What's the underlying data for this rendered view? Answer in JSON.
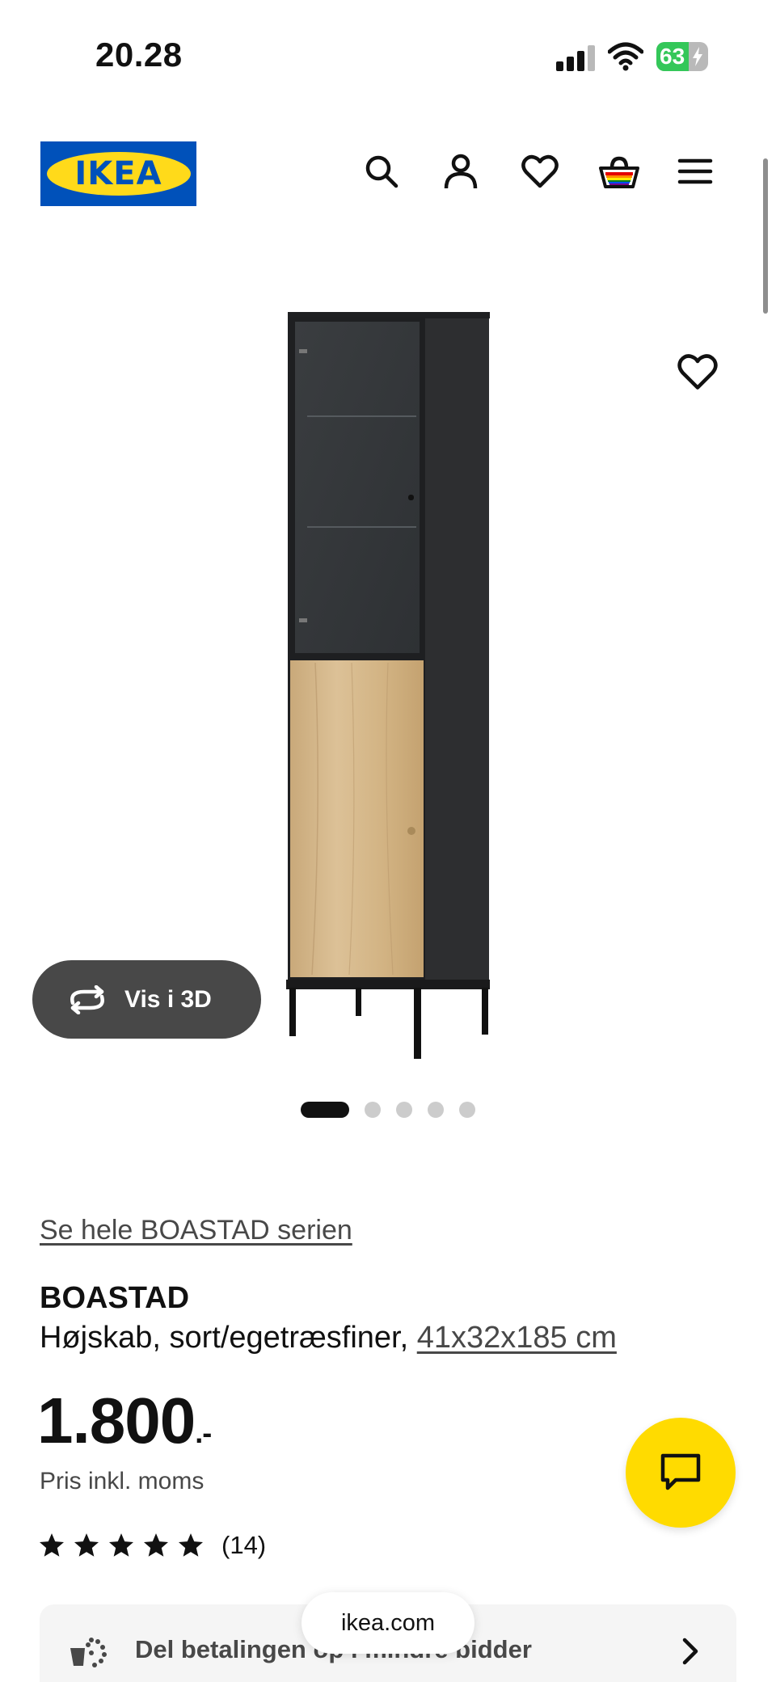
{
  "status_bar": {
    "time": "20.28",
    "battery_percent": "63",
    "battery_level": 0.63,
    "battery_color": "#34c759"
  },
  "header": {
    "logo_text": "IKEA",
    "logo_colors": {
      "blue": "#0051ba",
      "yellow": "#ffda1a"
    },
    "icons": [
      "search-icon",
      "profile-icon",
      "heart-icon",
      "basket-icon",
      "menu-icon"
    ]
  },
  "gallery": {
    "view_3d_label": "Vis i 3D",
    "slide_count": 5,
    "active_slide": 1
  },
  "product": {
    "series_link": "Se hele BOASTAD serien",
    "name": "BOASTAD",
    "description": "Højskab, sort/egetræsfiner,",
    "size_link": "41x32x185 cm",
    "price": "1.800",
    "price_suffix": ".-",
    "price_note": "Pris inkl. moms",
    "rating_stars": 5,
    "rating_count": "(14)"
  },
  "installments": {
    "label": "Del betalingen op i mindre bidder"
  },
  "browser": {
    "url": "ikea.com"
  },
  "colors": {
    "chat_button": "#ffdb00",
    "button_dark": "#484848"
  }
}
